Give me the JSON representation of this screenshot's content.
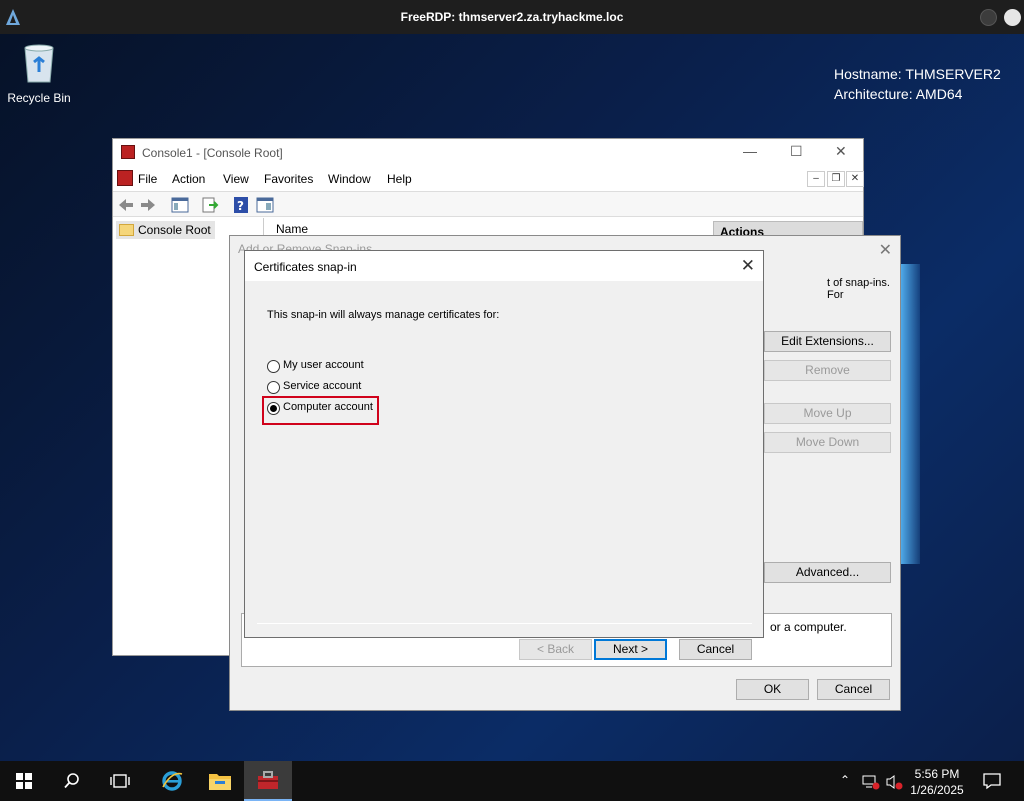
{
  "rdp": {
    "title": "FreeRDP: thmserver2.za.tryhackme.loc"
  },
  "desktop": {
    "recycle_bin_label": "Recycle Bin",
    "hostname": "Hostname: THMSERVER2",
    "architecture": "Architecture: AMD64"
  },
  "console": {
    "title": "Console1 - [Console Root]",
    "menu": [
      "File",
      "Action",
      "View",
      "Favorites",
      "Window",
      "Help"
    ],
    "tree_root": "Console Root",
    "column_name": "Name",
    "actions_header": "Actions"
  },
  "snapins_dialog": {
    "title": "Add or Remove Snap-ins",
    "text_fragment": "t of snap-ins. For",
    "buttons": {
      "edit_extensions": "Edit Extensions...",
      "remove": "Remove",
      "move_up": "Move Up",
      "move_down": "Move Down",
      "advanced": "Advanced...",
      "ok": "OK",
      "cancel": "Cancel"
    },
    "description_fragment": "or a computer."
  },
  "cert_dialog": {
    "title": "Certificates snap-in",
    "prompt": "This snap-in will always manage certificates for:",
    "options": [
      {
        "label": "My user account",
        "selected": false
      },
      {
        "label": "Service account",
        "selected": false
      },
      {
        "label": "Computer account",
        "selected": true
      }
    ],
    "buttons": {
      "back": "< Back",
      "next": "Next >",
      "cancel": "Cancel"
    }
  },
  "taskbar": {
    "time": "5:56 PM",
    "date": "1/26/2025"
  }
}
